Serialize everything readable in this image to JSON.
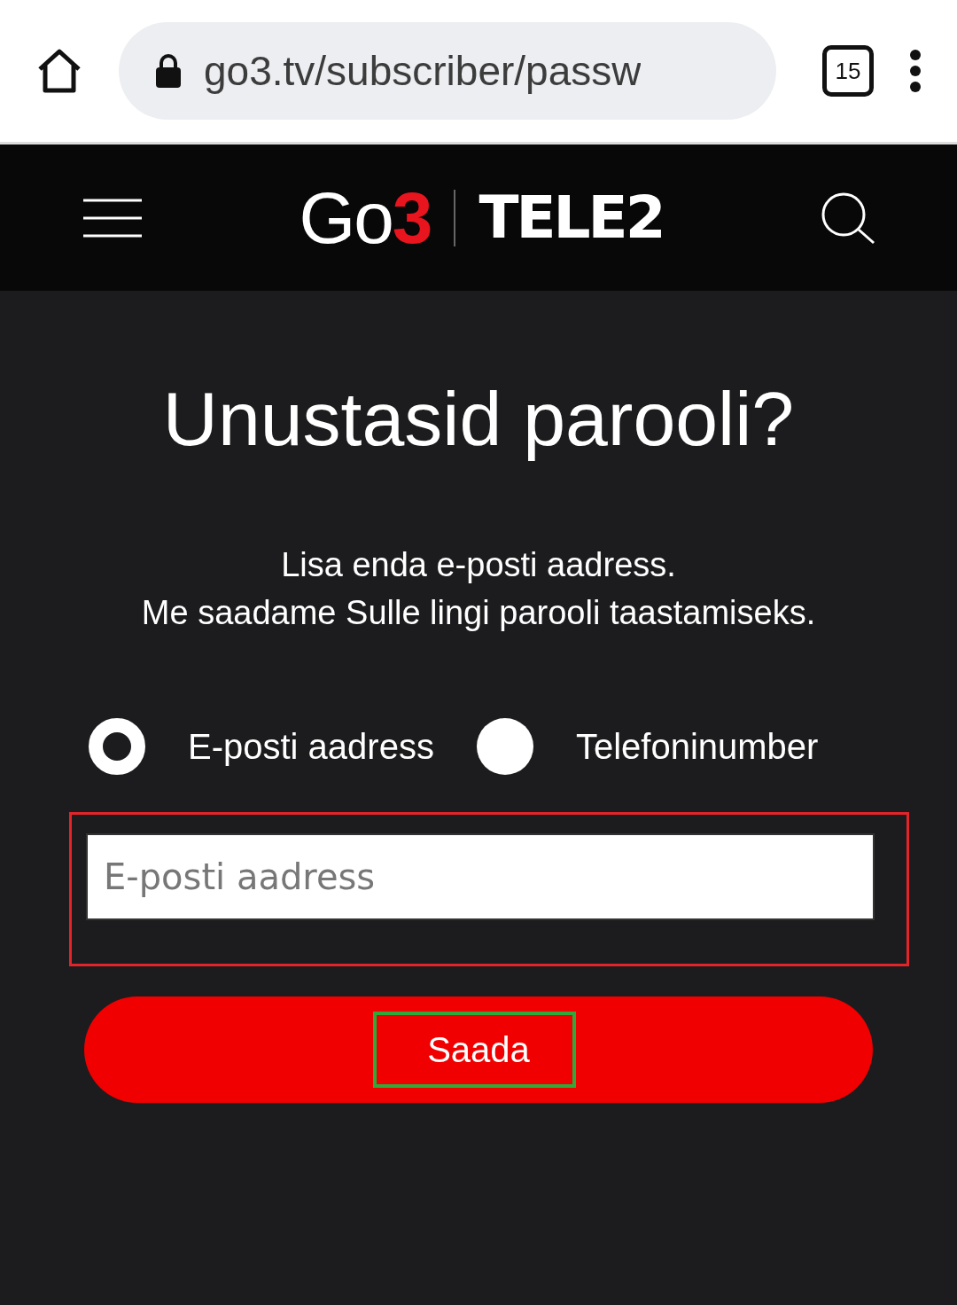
{
  "browser": {
    "url": "go3.tv/subscriber/passw",
    "tab_count": "15"
  },
  "header": {
    "logo": {
      "main": "Go",
      "accent": "3"
    },
    "partner": "TELE2"
  },
  "title": "Unustasid parooli?",
  "description": [
    "Lisa enda e-posti aadress.",
    "Me saadame Sulle lingi parooli taastamiseks."
  ],
  "options": [
    {
      "label": "E-posti aadress",
      "selected": true
    },
    {
      "label": "Telefoninumber",
      "selected": false
    }
  ],
  "email_field": {
    "placeholder": "E-posti aadress",
    "highlighted": true
  },
  "submit": {
    "label": "Saada",
    "highlighted": true
  }
}
